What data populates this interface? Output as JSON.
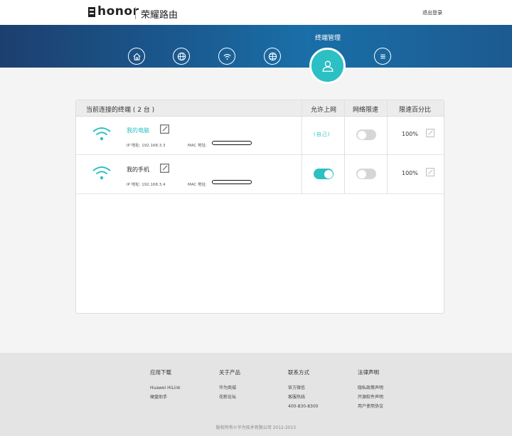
{
  "header": {
    "logo_text": "honor",
    "brand": "荣耀路由",
    "logout": "退出登录"
  },
  "nav": {
    "active_label": "终端管理",
    "items": [
      "home-icon",
      "globe-icon",
      "wifi-icon",
      "globe-settings-icon",
      "user-icon",
      "menu-icon"
    ]
  },
  "table": {
    "title": "当前连接的终端 ( 2 台 )",
    "col_allow": "允许上网",
    "col_limit": "网络限速",
    "col_pct": "限速百分比",
    "rows": [
      {
        "name": "我的电脑",
        "ip_label": "IP 地址: 192.168.3.3",
        "mac_label": "MAC 地址:",
        "allow": "(自己)",
        "limit_on": false,
        "pct": "100%"
      },
      {
        "name": "我的手机",
        "ip_label": "IP 地址: 192.168.3.4",
        "mac_label": "MAC 地址:",
        "allow_on": true,
        "limit_on": false,
        "pct": "100%"
      }
    ]
  },
  "colors": {
    "accent": "#2cbfc3",
    "banner": "#1a5d94",
    "toggle_off": "#d6d6d6"
  },
  "footer": {
    "col1": {
      "title": "应用下载",
      "items": [
        "Huawei HiLink",
        "硬盘助手"
      ]
    },
    "col2": {
      "title": "关于产品",
      "items": [
        "华为商城",
        "花粉论坛"
      ]
    },
    "col3": {
      "title": "联系方式",
      "items": [
        "官方微信",
        "客服热线",
        "400-830-8300"
      ]
    },
    "col4": {
      "title": "法律声明",
      "items": [
        "隐私政策声明",
        "开源软件声明",
        "用户使用协议"
      ]
    },
    "copyright": "版权所有©华为技术有限公司 2012-2015"
  }
}
